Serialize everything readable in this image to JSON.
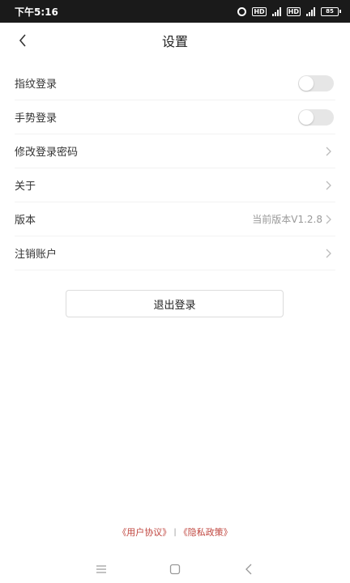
{
  "status_bar": {
    "time": "下午5:16",
    "hd1": "HD",
    "hd2": "HD",
    "battery": "85"
  },
  "header": {
    "title": "设置"
  },
  "settings": {
    "fingerprint_label": "指纹登录",
    "fingerprint_enabled": false,
    "gesture_label": "手势登录",
    "gesture_enabled": false,
    "change_password_label": "修改登录密码",
    "about_label": "关于",
    "version_label": "版本",
    "version_value": "当前版本V1.2.8",
    "deactivate_label": "注销账户"
  },
  "logout": {
    "label": "退出登录"
  },
  "footer": {
    "user_agreement": "《用户协议》",
    "separator": "|",
    "privacy_policy": "《隐私政策》"
  },
  "colors": {
    "status_bar_bg": "#1a1a1a",
    "link": "#c0463f",
    "toggle_off": "#e6e6e6"
  },
  "icons": {
    "back": "chevron-left-icon",
    "row_arrow": "chevron-right-icon",
    "nav_menu": "menu-icon",
    "nav_home": "square-icon",
    "nav_back": "triangle-back-icon"
  }
}
